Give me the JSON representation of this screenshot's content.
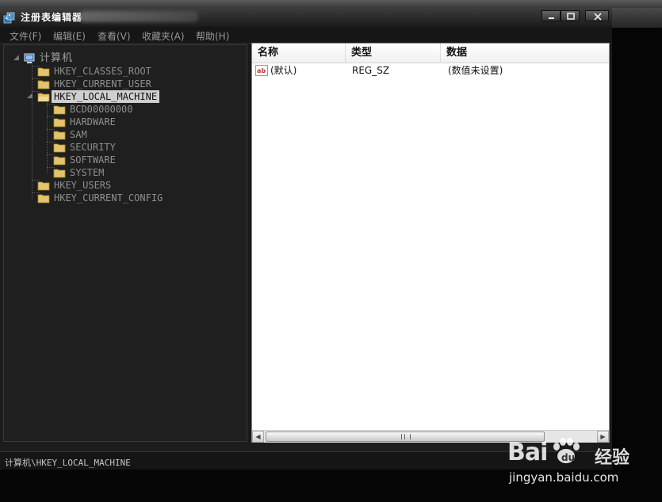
{
  "window": {
    "title": "注册表编辑器"
  },
  "menu": [
    {
      "label": "文件(F)"
    },
    {
      "label": "编辑(E)"
    },
    {
      "label": "查看(V)"
    },
    {
      "label": "收藏夹(A)"
    },
    {
      "label": "帮助(H)"
    }
  ],
  "tree": {
    "root": "计算机",
    "hives": [
      {
        "label": "HKEY_CLASSES_ROOT"
      },
      {
        "label": "HKEY_CURRENT_USER"
      },
      {
        "label": "HKEY_LOCAL_MACHINE",
        "selected": true
      },
      {
        "label": "HKEY_USERS"
      },
      {
        "label": "HKEY_CURRENT_CONFIG"
      }
    ],
    "children": [
      {
        "label": "BCD00000000"
      },
      {
        "label": "HARDWARE"
      },
      {
        "label": "SAM"
      },
      {
        "label": "SECURITY"
      },
      {
        "label": "SOFTWARE"
      },
      {
        "label": "SYSTEM"
      }
    ]
  },
  "list": {
    "columns": [
      "名称",
      "类型",
      "数据"
    ],
    "rows": [
      {
        "name": "(默认)",
        "type": "REG_SZ",
        "data": "(数值未设置)",
        "icon": "string-value-icon"
      }
    ]
  },
  "statusbar": {
    "path": "计算机\\HKEY_LOCAL_MACHINE"
  },
  "watermark": {
    "brand": "Bai",
    "brand_tail": "经验",
    "url": "jingyan.baidu.com"
  },
  "colors": {
    "selection": "#cfcfcf",
    "folder": "#e3c36b"
  }
}
